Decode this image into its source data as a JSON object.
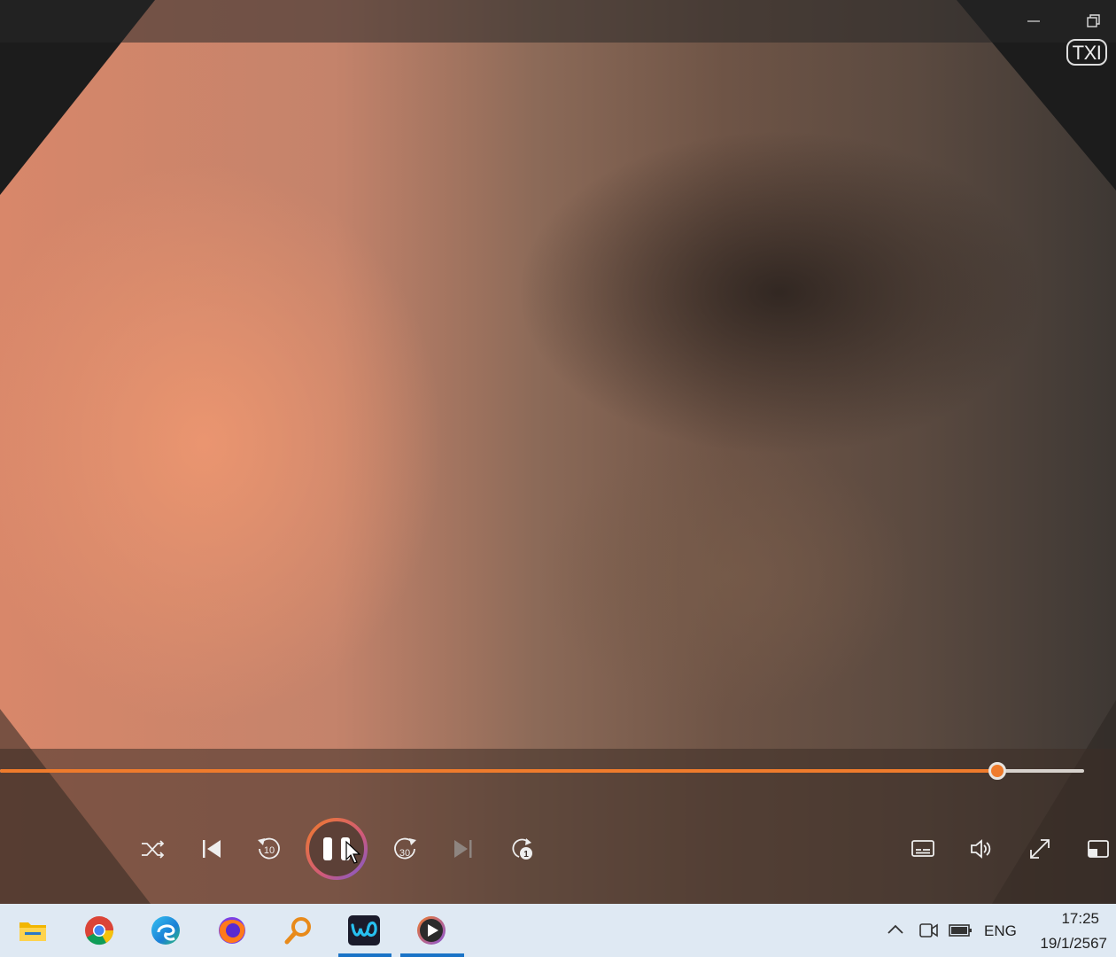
{
  "app": {
    "name": "Media Player",
    "overlay_label": "TXI",
    "accent_color": "#ef7b2c"
  },
  "window_controls": [
    {
      "name": "minimize-icon"
    },
    {
      "name": "restore-icon"
    }
  ],
  "playback": {
    "state": "playing",
    "progress": 0.92,
    "controls": [
      {
        "name": "shuffle-icon"
      },
      {
        "name": "previous-icon"
      },
      {
        "name": "rewind-10-icon",
        "label": "10"
      },
      {
        "name": "pause-icon"
      },
      {
        "name": "forward-30-icon",
        "label": "30"
      },
      {
        "name": "next-icon"
      },
      {
        "name": "repeat-one-icon",
        "label": "1"
      }
    ],
    "right_controls": [
      {
        "name": "subtitles-icon"
      },
      {
        "name": "volume-icon"
      },
      {
        "name": "fullscreen-icon"
      },
      {
        "name": "mini-player-icon"
      }
    ]
  },
  "taskbar": {
    "apps": [
      {
        "name": "file-explorer-icon"
      },
      {
        "name": "chrome-icon"
      },
      {
        "name": "edge-icon"
      },
      {
        "name": "firefox-icon"
      },
      {
        "name": "search-app-icon"
      },
      {
        "name": "webex-icon",
        "active": true
      },
      {
        "name": "media-player-icon",
        "active": true
      }
    ],
    "tray": {
      "chevron": "chevron-up-icon",
      "meet": "meet-now-icon",
      "battery": "battery-icon",
      "language": "ENG"
    },
    "clock": {
      "time": "17:25",
      "date": "19/1/2567"
    }
  }
}
